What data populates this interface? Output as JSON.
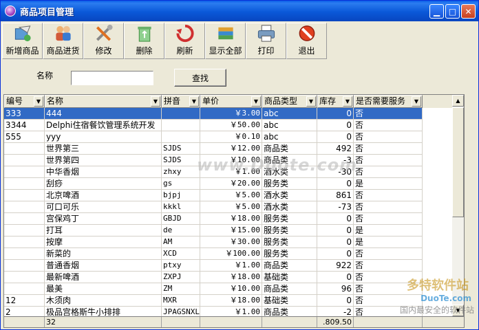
{
  "window": {
    "title": "商品项目管理"
  },
  "toolbar": {
    "items": [
      {
        "label": "新增商品",
        "icon": "add-product-icon"
      },
      {
        "label": "商品进货",
        "icon": "users-icon"
      },
      {
        "label": "修改",
        "icon": "tools-icon"
      },
      {
        "label": "删除",
        "icon": "recycle-bin-icon"
      },
      {
        "label": "刷新",
        "icon": "refresh-icon"
      },
      {
        "label": "显示全部",
        "icon": "books-icon"
      },
      {
        "label": "打印",
        "icon": "printer-icon"
      },
      {
        "label": "退出",
        "icon": "exit-icon"
      }
    ]
  },
  "search": {
    "label": "名称",
    "value": "",
    "button": "查找"
  },
  "grid": {
    "columns": [
      "编号",
      "名称",
      "拼音",
      "单价",
      "商品类型",
      "库存",
      "是否需要服务"
    ],
    "rows": [
      [
        "333",
        "444",
        "",
        "￥3.00",
        "abc",
        "0",
        "否"
      ],
      [
        "3344",
        "Delphi住宿餐饮管理系统开发",
        "",
        "￥50.00",
        "abc",
        "0",
        "否"
      ],
      [
        "555",
        "yyy",
        "",
        "￥0.10",
        "abc",
        "0",
        "否"
      ],
      [
        "",
        "世界第三",
        "SJDS",
        "￥12.00",
        "商品类",
        "492",
        "否"
      ],
      [
        "",
        "世界第四",
        "SJDS",
        "￥10.00",
        "商品类",
        "-3",
        "否"
      ],
      [
        "",
        "中华香烟",
        "zhxy",
        "￥1.00",
        "酒水类",
        "-30",
        "否"
      ],
      [
        "",
        "刮痧",
        "gs",
        "￥20.00",
        "服务类",
        "0",
        "是"
      ],
      [
        "",
        "北京啤酒",
        "bjpj",
        "￥5.00",
        "酒水类",
        "861",
        "否"
      ],
      [
        "",
        "可口可乐",
        "kkkl",
        "￥5.00",
        "酒水类",
        "-73",
        "否"
      ],
      [
        "",
        "宫保鸡丁",
        "GBJD",
        "￥18.00",
        "服务类",
        "0",
        "否"
      ],
      [
        "",
        "打耳",
        "de",
        "￥15.00",
        "服务类",
        "0",
        "是"
      ],
      [
        "",
        "按摩",
        "AM",
        "￥30.00",
        "服务类",
        "0",
        "是"
      ],
      [
        "",
        "新菜的",
        "XCD",
        "￥100.00",
        "服务类",
        "0",
        "否"
      ],
      [
        "",
        "普通香烟",
        "ptxy",
        "￥1.00",
        "商品类",
        "922",
        "否"
      ],
      [
        "",
        "最新啤酒",
        "ZXPJ",
        "￥18.00",
        "基础类",
        "0",
        "否"
      ],
      [
        "",
        "最美",
        "ZM",
        "￥10.00",
        "商品类",
        "96",
        "否"
      ],
      [
        "12",
        "木须肉",
        "MXR",
        "￥18.00",
        "基础类",
        "0",
        "否"
      ],
      [
        "2",
        "极品宫格斯牛小排排",
        "JPAGSNXL",
        "￥1.00",
        "商品类",
        "-2",
        "否"
      ]
    ],
    "footer": [
      "",
      "32",
      "",
      "",
      "",
      ".809.50",
      ""
    ]
  },
  "watermark": {
    "text": "www.Duote.com",
    "logo": "多特软件站",
    "logo_sub": "DuoTe.com",
    "tagline": "国内最安全的软件站"
  }
}
